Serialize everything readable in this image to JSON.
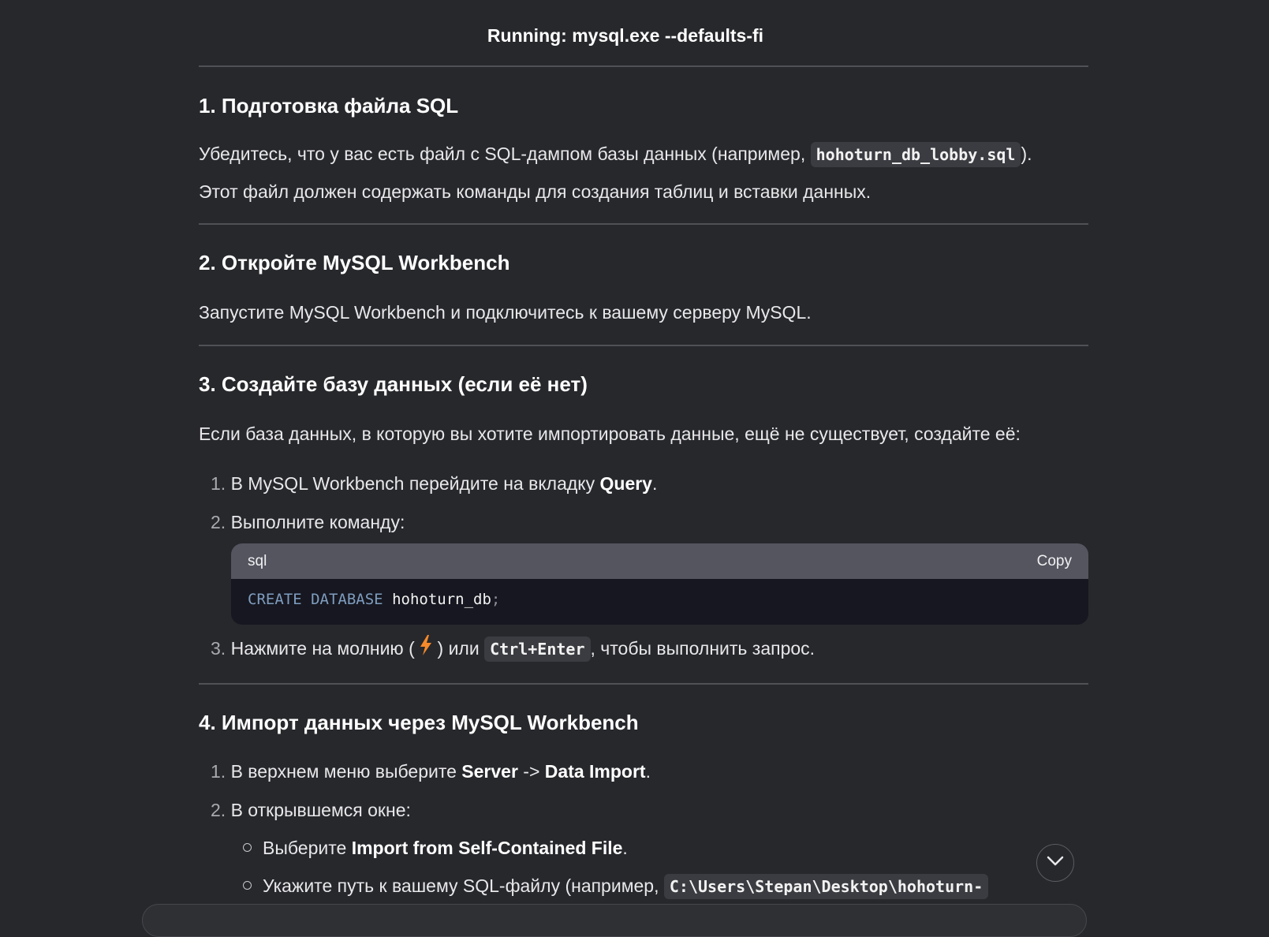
{
  "header": {
    "title": "Running: mysql.exe --defaults-fi"
  },
  "sections": [
    {
      "heading": "1. Подготовка файла SQL",
      "para_line1_before": "Убедитесь, что у вас есть файл с SQL-дампом базы данных (например, ",
      "para_line1_code": "hohoturn_db_lobby.sql",
      "para_line1_after": ").",
      "para_line2": "Этот файл должен содержать команды для создания таблиц и вставки данных."
    },
    {
      "heading": "2. Откройте MySQL Workbench",
      "para": "Запустите MySQL Workbench и подключитесь к вашему серверу MySQL."
    },
    {
      "heading": "3. Создайте базу данных (если её нет)",
      "para": "Если база данных, в которую вы хотите импортировать данные, ещё не существует, создайте её:",
      "steps": [
        {
          "num": "1.",
          "before": "В MySQL Workbench перейдите на вкладку ",
          "bold": "Query",
          "after": "."
        },
        {
          "num": "2.",
          "text": "Выполните команду:"
        },
        {
          "num": "3.",
          "before": "Нажмите на молнию (",
          "after_icon": ") или ",
          "code": "Ctrl+Enter",
          "after": ", чтобы выполнить запрос."
        }
      ],
      "codeblock": {
        "lang": "sql",
        "copy_label": "Copy",
        "kw1": "CREATE",
        "kw2": "DATABASE",
        "ident": "hohoturn_db",
        "semi": ";"
      }
    },
    {
      "heading": "4. Импорт данных через MySQL Workbench",
      "steps": [
        {
          "num": "1.",
          "before": "В верхнем меню выберите ",
          "bold1": "Server",
          "mid": " -> ",
          "bold2": "Data Import",
          "after": "."
        },
        {
          "num": "2.",
          "text": "В открывшемся окне:"
        }
      ],
      "subitems": [
        {
          "before": "Выберите ",
          "bold": "Import from Self-Contained File",
          "after": "."
        },
        {
          "before": "Укажите путь к вашему SQL-файлу (например, ",
          "code": "C:\\Users\\Stepan\\Desktop\\hohoturn-"
        }
      ]
    }
  ],
  "icons": {
    "bolt": "lightning-bolt-icon",
    "scroll": "chevron-down-icon"
  },
  "colors": {
    "background": "#27282c",
    "bolt": "#f58a2a",
    "keyword": "#7f9dbf"
  }
}
